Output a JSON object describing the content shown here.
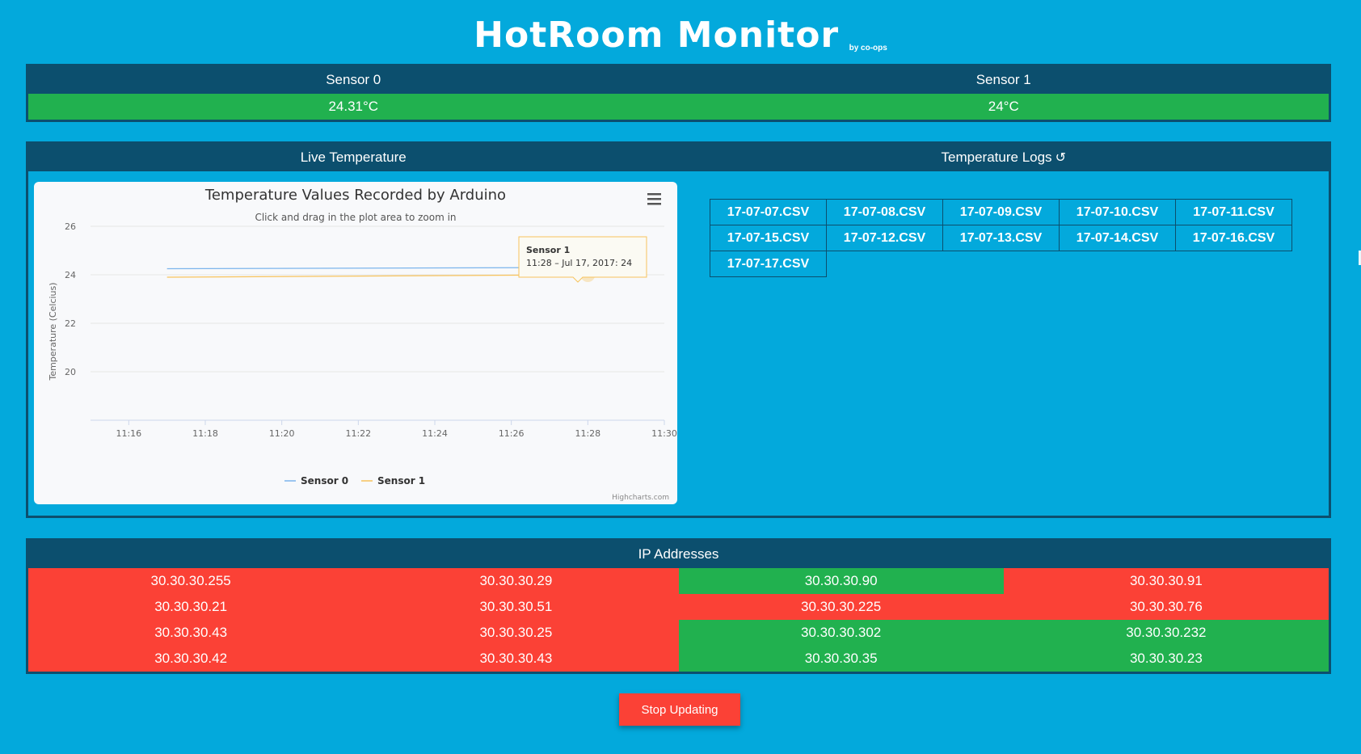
{
  "app": {
    "title": "HotRoom Monitor",
    "subtitle": "by co-ops"
  },
  "sensors": [
    {
      "name": "Sensor 0",
      "value": "24.31°C"
    },
    {
      "name": "Sensor 1",
      "value": "24°C"
    }
  ],
  "live": {
    "heading": "Live Temperature"
  },
  "logs": {
    "heading": "Temperature Logs",
    "refresh_icon": "refresh-icon",
    "files": [
      "17-07-07.CSV",
      "17-07-08.CSV",
      "17-07-09.CSV",
      "17-07-10.CSV",
      "17-07-11.CSV",
      "17-07-15.CSV",
      "17-07-12.CSV",
      "17-07-13.CSV",
      "17-07-14.CSV",
      "17-07-16.CSV",
      "17-07-17.CSV"
    ]
  },
  "chart_data": {
    "type": "line",
    "title": "Temperature Values Recorded by Arduino",
    "subtitle": "Click and drag in the plot area to zoom in",
    "ylabel": "Temperature (Celcius)",
    "xlabel": "",
    "y_ticks": [
      "20",
      "22",
      "24",
      "26"
    ],
    "x_ticks": [
      "11:16",
      "11:18",
      "11:20",
      "11:22",
      "11:24",
      "11:26",
      "11:28",
      "11:30"
    ],
    "ylim": [
      18,
      26
    ],
    "xlim": [
      "11:15",
      "11:30"
    ],
    "grid": true,
    "legend_placement": "bottom-center",
    "series": [
      {
        "name": "Sensor 0",
        "color": "#7cb5ec",
        "x": [
          "11:17",
          "11:28"
        ],
        "y": [
          24.25,
          24.3
        ]
      },
      {
        "name": "Sensor 1",
        "color": "#f7c35c",
        "x": [
          "11:17",
          "11:28"
        ],
        "y": [
          23.9,
          24
        ]
      }
    ],
    "tooltip": {
      "series": "Sensor 1",
      "text": "11:28 – Jul 17, 2017: 24"
    },
    "credits": "Highcharts.com",
    "menu_icon": "hamburger-menu-icon"
  },
  "ips": {
    "heading": "IP Addresses",
    "rows": [
      [
        {
          "ip": "30.30.30.255",
          "status": "red"
        },
        {
          "ip": "30.30.30.29",
          "status": "red"
        },
        {
          "ip": "30.30.30.90",
          "status": "green"
        },
        {
          "ip": "30.30.30.91",
          "status": "red"
        }
      ],
      [
        {
          "ip": "30.30.30.21",
          "status": "red"
        },
        {
          "ip": "30.30.30.51",
          "status": "red"
        },
        {
          "ip": "30.30.30.225",
          "status": "red"
        },
        {
          "ip": "30.30.30.76",
          "status": "red"
        }
      ],
      [
        {
          "ip": "30.30.30.43",
          "status": "red"
        },
        {
          "ip": "30.30.30.25",
          "status": "red"
        },
        {
          "ip": "30.30.30.302",
          "status": "green"
        },
        {
          "ip": "30.30.30.232",
          "status": "green"
        }
      ],
      [
        {
          "ip": "30.30.30.42",
          "status": "red"
        },
        {
          "ip": "30.30.30.43",
          "status": "red"
        },
        {
          "ip": "30.30.30.35",
          "status": "green"
        },
        {
          "ip": "30.30.30.23",
          "status": "green"
        }
      ]
    ],
    "colors": {
      "red": "#fb4136",
      "green": "#21b14f"
    }
  },
  "controls": {
    "stop_label": "Stop Updating"
  },
  "theme": {
    "background": "#03a9dc",
    "header_bar": "#0c4f6e"
  }
}
